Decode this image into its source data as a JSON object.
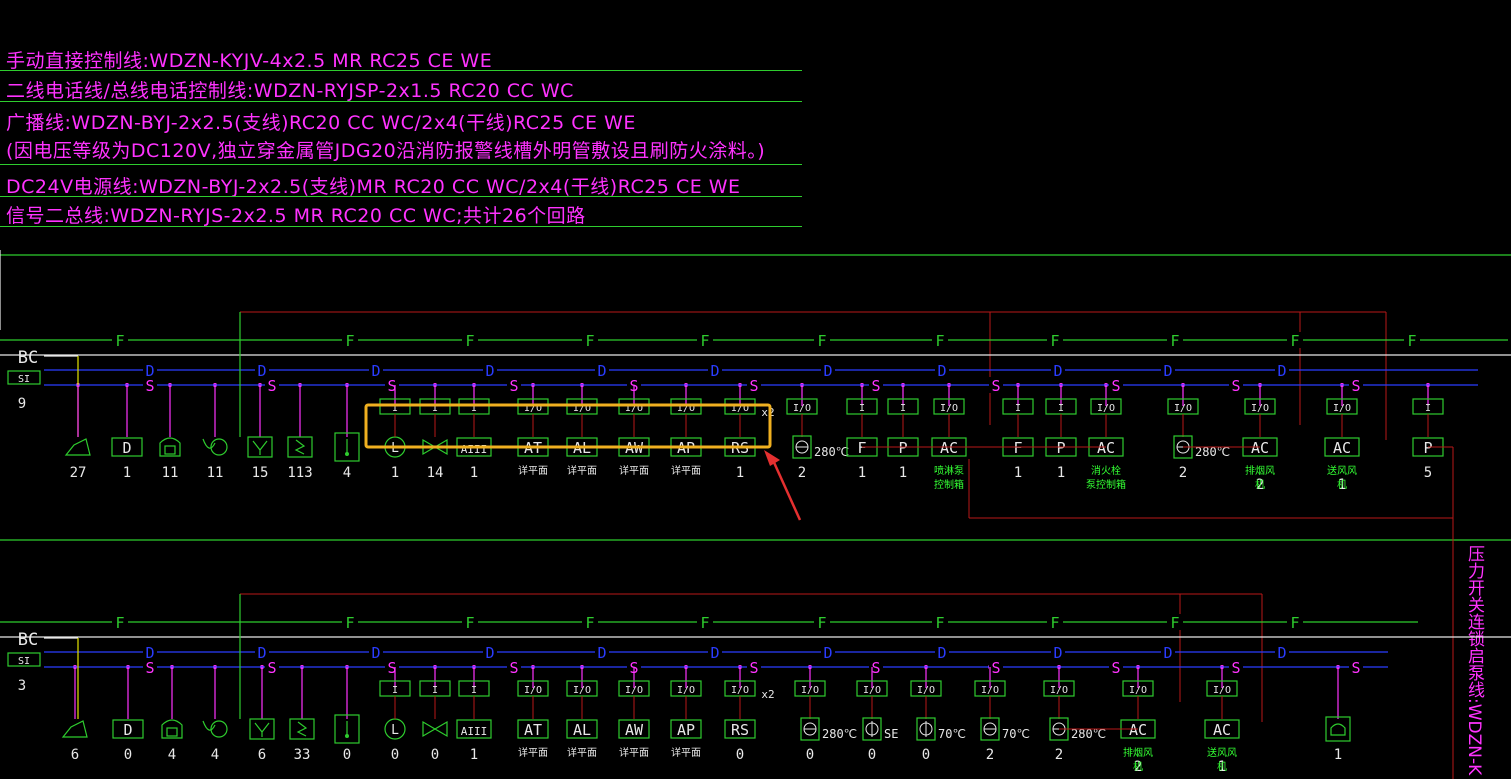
{
  "legend": {
    "lines": [
      "手动直接控制线:WDZN-KYJV-4x2.5 MR RC25 CE WE",
      "二线电话线/总线电话控制线:WDZN-RYJSP-2x1.5 RC20 CC WC",
      "广播线:WDZN-BYJ-2x2.5(支线)RC20 CC WC/2x4(干线)RC25 CE WE",
      "(因电压等级为DC120V,独立穿金属管JDG20沿消防报警线槽外明管敷设且刷防火涂料。)",
      "DC24V电源线:WDZN-BYJ-2x2.5(支线)MR RC20 CC WC/2x4(干线)RC25 CE WE",
      "信号二总线:WDZN-RYJS-2x2.5 MR RC20 CC WC;共计26个回路"
    ]
  },
  "vertical_label": "压力开关连锁启泵线:WDZN-K",
  "bus_letters": {
    "fire": "F",
    "data": "D",
    "signal": "S"
  },
  "colors": {
    "background": "#000000",
    "text_magenta": "#ff33ff",
    "green": "#2ecc2e",
    "blue": "#2a3cff",
    "red": "#b81818",
    "yellow": "#e6e600",
    "white": "#e8e8e8",
    "highlight": "#f0b020",
    "arrow": "#e53030"
  },
  "panels": [
    {
      "name": "upper",
      "bc_label": "BC",
      "si_label": "SI",
      "si_count": "9",
      "x2_label": "x2",
      "devices": [
        {
          "symbol": "speaker-icon",
          "module": "",
          "count": "27",
          "note": ""
        },
        {
          "symbol": "D",
          "module": "",
          "count": "1",
          "note": ""
        },
        {
          "symbol": "phone-icon",
          "module": "",
          "count": "11",
          "note": ""
        },
        {
          "symbol": "alarm-bell-icon",
          "module": "",
          "count": "11",
          "note": ""
        },
        {
          "symbol": "manual-station-icon",
          "module": "",
          "count": "15",
          "note": ""
        },
        {
          "symbol": "zigzag-icon",
          "module": "",
          "count": "113",
          "note": ""
        },
        {
          "symbol": "thermometer-icon",
          "module": "",
          "count": "4",
          "note": ""
        },
        {
          "symbol": "L",
          "module": "I",
          "count": "1",
          "note": ""
        },
        {
          "symbol": "valve-icon",
          "module": "I",
          "count": "14",
          "note": ""
        },
        {
          "symbol": "AIII",
          "module": "I",
          "count": "1",
          "note": ""
        },
        {
          "symbol": "AT",
          "module": "I/O",
          "count": "",
          "note": "详平面"
        },
        {
          "symbol": "AL",
          "module": "I/O",
          "count": "",
          "note": "详平面"
        },
        {
          "symbol": "AW",
          "module": "I/O",
          "count": "",
          "note": "详平面"
        },
        {
          "symbol": "AP",
          "module": "I/O",
          "count": "",
          "note": "详平面"
        },
        {
          "symbol": "RS",
          "module": "I/O",
          "count": "1",
          "note": ""
        },
        {
          "symbol": "damper-icon",
          "module": "I/O",
          "count": "2",
          "note": "",
          "temp": "280℃"
        },
        {
          "symbol": "F",
          "module": "I",
          "count": "1",
          "note": ""
        },
        {
          "symbol": "P",
          "module": "I",
          "count": "1",
          "note": ""
        },
        {
          "symbol": "AC",
          "module": "I/O",
          "count": "",
          "note": "喷淋泵控制箱"
        },
        {
          "symbol": "F",
          "module": "I",
          "count": "1",
          "note": ""
        },
        {
          "symbol": "P",
          "module": "I",
          "count": "1",
          "note": ""
        },
        {
          "symbol": "AC",
          "module": "I/O",
          "count": "",
          "note": "消火栓泵控制箱"
        },
        {
          "symbol": "damper-icon",
          "module": "I/O",
          "count": "2",
          "note": "",
          "temp": "280℃"
        },
        {
          "symbol": "AC",
          "module": "I/O",
          "count": "2",
          "note": "排烟风机"
        },
        {
          "symbol": "AC",
          "module": "I/O",
          "count": "1",
          "note": "送风风机"
        },
        {
          "symbol": "P",
          "module": "I",
          "count": "5",
          "note": ""
        }
      ]
    },
    {
      "name": "lower",
      "bc_label": "BC",
      "si_label": "SI",
      "si_count": "3",
      "x2_label": "x2",
      "devices": [
        {
          "symbol": "speaker-icon",
          "module": "",
          "count": "6",
          "note": ""
        },
        {
          "symbol": "D",
          "module": "",
          "count": "0",
          "note": ""
        },
        {
          "symbol": "phone-icon",
          "module": "",
          "count": "4",
          "note": ""
        },
        {
          "symbol": "alarm-bell-icon",
          "module": "",
          "count": "4",
          "note": ""
        },
        {
          "symbol": "manual-station-icon",
          "module": "",
          "count": "6",
          "note": ""
        },
        {
          "symbol": "zigzag-icon",
          "module": "",
          "count": "33",
          "note": ""
        },
        {
          "symbol": "thermometer-icon",
          "module": "",
          "count": "0",
          "note": ""
        },
        {
          "symbol": "L",
          "module": "I",
          "count": "0",
          "note": ""
        },
        {
          "symbol": "valve-icon",
          "module": "I",
          "count": "0",
          "note": ""
        },
        {
          "symbol": "AIII",
          "module": "I",
          "count": "1",
          "note": ""
        },
        {
          "symbol": "AT",
          "module": "I/O",
          "count": "",
          "note": "详平面"
        },
        {
          "symbol": "AL",
          "module": "I/O",
          "count": "",
          "note": "详平面"
        },
        {
          "symbol": "AW",
          "module": "I/O",
          "count": "",
          "note": "详平面"
        },
        {
          "symbol": "AP",
          "module": "I/O",
          "count": "",
          "note": "详平面"
        },
        {
          "symbol": "RS",
          "module": "I/O",
          "count": "0",
          "note": ""
        },
        {
          "symbol": "damper-icon",
          "module": "I/O",
          "count": "0",
          "note": "",
          "temp": "280℃"
        },
        {
          "symbol": "damper-phi-icon",
          "module": "I/O",
          "count": "0",
          "note": "",
          "temp": "SE"
        },
        {
          "symbol": "damper-phi-icon",
          "module": "I/O",
          "count": "0",
          "note": "",
          "temp": "70℃"
        },
        {
          "symbol": "damper-icon",
          "module": "I/O",
          "count": "2",
          "note": "",
          "temp": "70℃"
        },
        {
          "symbol": "damper-icon",
          "module": "I/O",
          "count": "2",
          "note": "",
          "temp": "280℃"
        },
        {
          "symbol": "AC",
          "module": "I/O",
          "count": "2",
          "note": "排烟风机"
        },
        {
          "symbol": "AC",
          "module": "I/O",
          "count": "1",
          "note": "送风风机"
        },
        {
          "symbol": "pressure-switch-icon",
          "module": "",
          "count": "1",
          "note": ""
        }
      ]
    }
  ]
}
